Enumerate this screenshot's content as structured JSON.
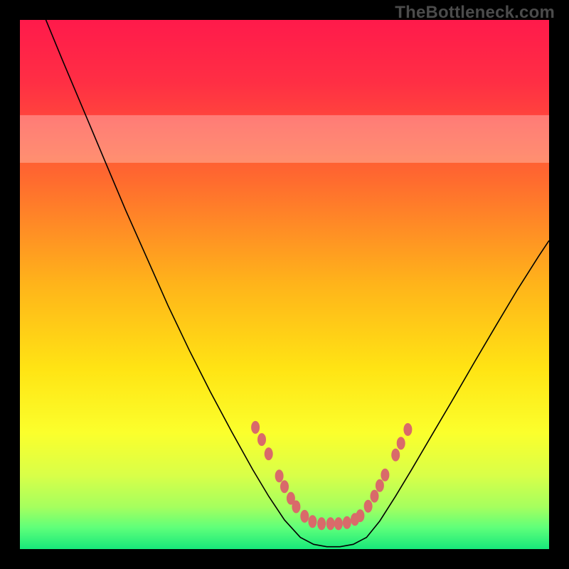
{
  "watermark": "TheBottleneck.com",
  "chart_data": {
    "type": "line",
    "title": "",
    "xlabel": "",
    "ylabel": "",
    "xlim": [
      0,
      100
    ],
    "ylim": [
      0,
      100
    ],
    "gradient_stops": [
      {
        "offset": 0.0,
        "color": "#ff1a4b"
      },
      {
        "offset": 0.12,
        "color": "#ff2f44"
      },
      {
        "offset": 0.3,
        "color": "#ff6a2f"
      },
      {
        "offset": 0.5,
        "color": "#ffb41a"
      },
      {
        "offset": 0.66,
        "color": "#ffe414"
      },
      {
        "offset": 0.78,
        "color": "#fbff2c"
      },
      {
        "offset": 0.86,
        "color": "#d9ff48"
      },
      {
        "offset": 0.92,
        "color": "#a6ff5e"
      },
      {
        "offset": 0.96,
        "color": "#5eff7a"
      },
      {
        "offset": 1.0,
        "color": "#17e87a"
      }
    ],
    "pale_band": {
      "y_from": 73,
      "y_to": 82,
      "opacity": 0.3
    },
    "series": [
      {
        "name": "bottleneck-curve",
        "color": "#000000",
        "width": 1.6,
        "points": [
          {
            "x": 4.5,
            "y": 101.0
          },
          {
            "x": 8.0,
            "y": 92.5
          },
          {
            "x": 12.0,
            "y": 83.0
          },
          {
            "x": 16.0,
            "y": 73.5
          },
          {
            "x": 20.0,
            "y": 64.0
          },
          {
            "x": 24.0,
            "y": 55.0
          },
          {
            "x": 28.0,
            "y": 46.0
          },
          {
            "x": 32.0,
            "y": 37.6
          },
          {
            "x": 36.0,
            "y": 29.7
          },
          {
            "x": 40.0,
            "y": 22.2
          },
          {
            "x": 44.0,
            "y": 15.0
          },
          {
            "x": 47.0,
            "y": 10.0
          },
          {
            "x": 50.0,
            "y": 5.5
          },
          {
            "x": 53.0,
            "y": 2.2
          },
          {
            "x": 55.5,
            "y": 0.9
          },
          {
            "x": 58.0,
            "y": 0.45
          },
          {
            "x": 60.5,
            "y": 0.45
          },
          {
            "x": 63.0,
            "y": 0.9
          },
          {
            "x": 65.5,
            "y": 2.2
          },
          {
            "x": 68.0,
            "y": 5.3
          },
          {
            "x": 71.0,
            "y": 10.0
          },
          {
            "x": 74.0,
            "y": 15.0
          },
          {
            "x": 78.0,
            "y": 21.8
          },
          {
            "x": 82.0,
            "y": 28.6
          },
          {
            "x": 86.0,
            "y": 35.5
          },
          {
            "x": 90.0,
            "y": 42.3
          },
          {
            "x": 94.0,
            "y": 49.0
          },
          {
            "x": 98.0,
            "y": 55.3
          },
          {
            "x": 100.0,
            "y": 58.3
          }
        ]
      }
    ],
    "markers": {
      "name": "highlight-dots",
      "color": "#d96a6a",
      "rx": 6,
      "ry": 9,
      "points": [
        {
          "x": 44.5,
          "y": 23.0
        },
        {
          "x": 45.7,
          "y": 20.7
        },
        {
          "x": 47.0,
          "y": 18.0
        },
        {
          "x": 49.0,
          "y": 13.8
        },
        {
          "x": 50.0,
          "y": 11.8
        },
        {
          "x": 51.2,
          "y": 9.6
        },
        {
          "x": 52.2,
          "y": 8.0
        },
        {
          "x": 53.8,
          "y": 6.2
        },
        {
          "x": 55.3,
          "y": 5.2
        },
        {
          "x": 57.0,
          "y": 4.8
        },
        {
          "x": 58.7,
          "y": 4.8
        },
        {
          "x": 60.2,
          "y": 4.8
        },
        {
          "x": 61.8,
          "y": 5.0
        },
        {
          "x": 63.3,
          "y": 5.6
        },
        {
          "x": 64.3,
          "y": 6.3
        },
        {
          "x": 65.8,
          "y": 8.1
        },
        {
          "x": 67.0,
          "y": 10.0
        },
        {
          "x": 68.0,
          "y": 12.0
        },
        {
          "x": 69.0,
          "y": 14.0
        },
        {
          "x": 71.0,
          "y": 17.8
        },
        {
          "x": 72.0,
          "y": 20.0
        },
        {
          "x": 73.3,
          "y": 22.6
        }
      ]
    }
  }
}
